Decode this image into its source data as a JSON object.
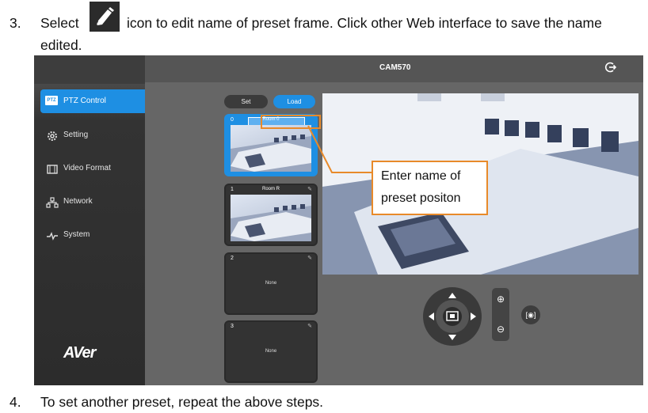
{
  "doc": {
    "step3": {
      "number": "3.",
      "before_icon": "Select",
      "after_icon": "icon to edit name of preset frame. Click other Web interface to save the name",
      "continuation": "edited."
    },
    "step4": {
      "number": "4.",
      "text": "To set another preset, repeat the above steps."
    }
  },
  "app": {
    "title": "CAM570",
    "logo": "AVer",
    "sidebar": [
      {
        "label": "PTZ Control",
        "icon": "ptz-icon",
        "active": true,
        "icon_text": "PTZ"
      },
      {
        "label": "Setting",
        "icon": "gear-icon",
        "active": false
      },
      {
        "label": "Video Format",
        "icon": "film-icon",
        "active": false
      },
      {
        "label": "Network",
        "icon": "network-icon",
        "active": false
      },
      {
        "label": "System",
        "icon": "pulse-icon",
        "active": false
      }
    ],
    "buttons": {
      "set": "Set",
      "load": "Load"
    },
    "presets": [
      {
        "index": "0",
        "name": "Room 0",
        "has_image": true,
        "selected": true
      },
      {
        "index": "1",
        "name": "Room R",
        "has_image": true,
        "selected": false
      },
      {
        "index": "2",
        "name": "None",
        "has_image": false,
        "selected": false
      },
      {
        "index": "3",
        "name": "None",
        "has_image": false,
        "selected": false
      }
    ],
    "callout": {
      "line1": "Enter name of",
      "line2": "preset positon"
    },
    "colors": {
      "accent": "#1e8fe3",
      "annotation": "#e88a2a",
      "sidebar": "#2c2c2c",
      "content": "#666666"
    }
  }
}
